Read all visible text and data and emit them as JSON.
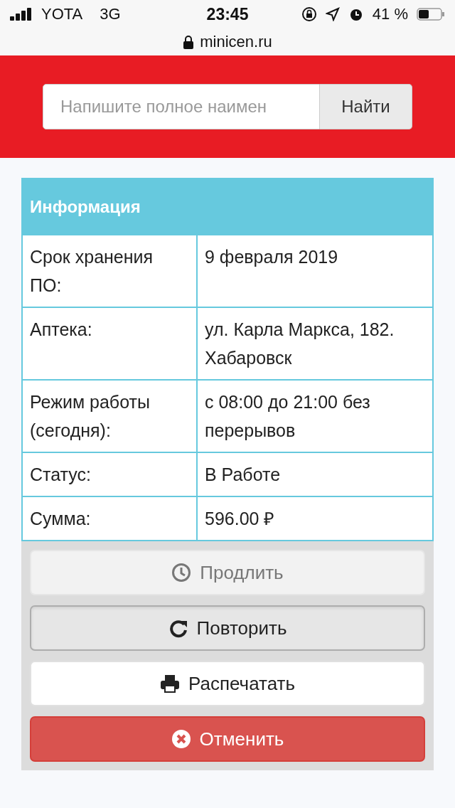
{
  "status_bar": {
    "carrier": "YOTA",
    "network": "3G",
    "time": "23:45",
    "battery": "41 %"
  },
  "address_bar": {
    "url": "minicen.ru"
  },
  "search": {
    "placeholder": "Напишите полное наимен",
    "button": "Найти"
  },
  "info": {
    "title": "Информация",
    "rows": [
      {
        "label": "Срок хранения ПО:",
        "value": "9 февраля 2019"
      },
      {
        "label": "Аптека:",
        "value": "ул. Карла Маркса, 182. Хабаровск"
      },
      {
        "label": "Режим работы (сегодня):",
        "value": "с 08:00 до 21:00 без перерывов"
      },
      {
        "label": "Статус:",
        "value": "В Работе"
      },
      {
        "label": "Сумма:",
        "value": "596.00 ₽"
      }
    ]
  },
  "actions": [
    {
      "kind": "extend",
      "label": "Продлить",
      "disabled": true,
      "pressed": false
    },
    {
      "kind": "repeat",
      "label": "Повторить",
      "disabled": false,
      "pressed": true
    },
    {
      "kind": "print",
      "label": "Распечатать",
      "disabled": false,
      "pressed": false
    },
    {
      "kind": "cancel",
      "label": "Отменить",
      "disabled": false,
      "pressed": false
    }
  ]
}
